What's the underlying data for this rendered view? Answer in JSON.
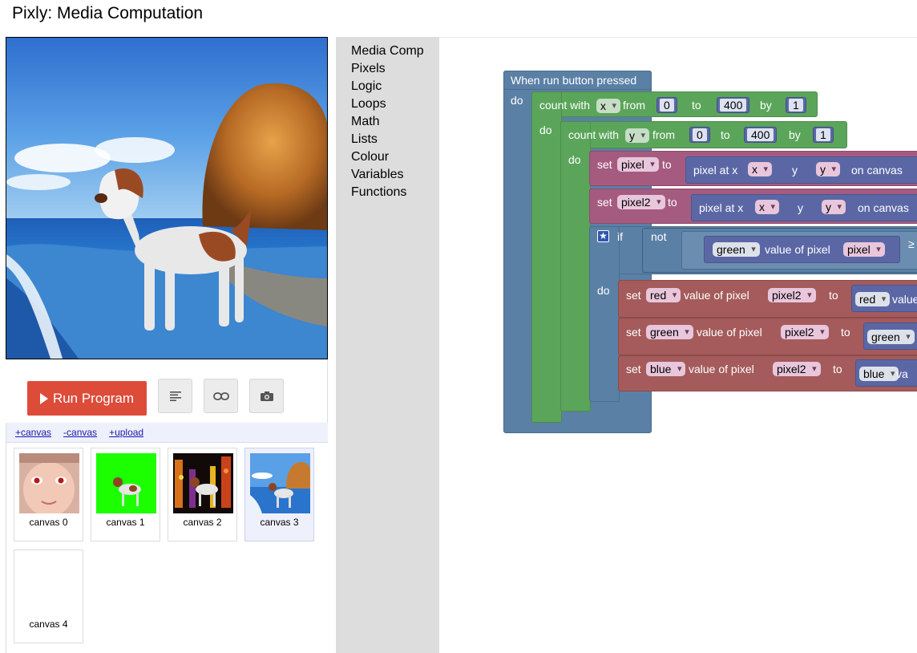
{
  "app": {
    "title": "Pixly: Media Computation"
  },
  "controls": {
    "run_label": "Run Program",
    "tools": [
      {
        "name": "code-view-icon"
      },
      {
        "name": "link-icon"
      },
      {
        "name": "camera-icon"
      }
    ]
  },
  "canvas_panel": {
    "toolbar": [
      "+canvas",
      "-canvas",
      "+upload"
    ],
    "canvases": [
      {
        "label": "canvas 0",
        "scene": "baby-portrait"
      },
      {
        "label": "canvas 1",
        "scene": "dog-on-green"
      },
      {
        "label": "canvas 2",
        "scene": "dog-on-city-night"
      },
      {
        "label": "canvas 3",
        "scene": "dog-on-beach",
        "selected": true
      },
      {
        "label": "canvas 4",
        "scene": "blank"
      }
    ]
  },
  "toolbox": {
    "categories": [
      "Media Comp",
      "Pixels",
      "Logic",
      "Loops",
      "Math",
      "Lists",
      "Colour",
      "Variables",
      "Functions"
    ]
  },
  "workspace": {
    "event": {
      "header": "When run button pressed",
      "do": "do"
    },
    "loop_x": {
      "label": "count with",
      "var": "x",
      "from": "from",
      "start": "0",
      "to": "to",
      "end": "400",
      "by": "by",
      "step": "1",
      "do": "do"
    },
    "loop_y": {
      "label": "count with",
      "var": "y",
      "from": "from",
      "start": "0",
      "to": "to",
      "end": "400",
      "by": "by",
      "step": "1",
      "do": "do"
    },
    "set_pixel": {
      "set": "set",
      "var": "pixel",
      "to": "to",
      "func": "pixel at x",
      "x": "x",
      "y_label": "y",
      "y": "y",
      "canvas": "on canvas"
    },
    "set_pixel2": {
      "set": "set",
      "var": "pixel2",
      "to": "to",
      "func": "pixel at x",
      "x": "x",
      "y_label": "y",
      "y": "y",
      "canvas": "on canvas"
    },
    "if_block": {
      "if": "if",
      "not": "not",
      "channel": "green",
      "value_of": "value of pixel",
      "pixel": "pixel",
      "compare": "≥",
      "do": "do"
    },
    "set_red": {
      "set": "set",
      "channel": "red",
      "value_of": "value of pixel",
      "pixel": "pixel2",
      "to": "to",
      "src_channel": "red",
      "src_value": "value"
    },
    "set_green": {
      "set": "set",
      "channel": "green",
      "value_of": "value of pixel",
      "pixel": "pixel2",
      "to": "to",
      "src_channel": "green"
    },
    "set_blue": {
      "set": "set",
      "channel": "blue",
      "value_of": "value of pixel",
      "pixel": "pixel2",
      "to": "to",
      "src_channel": "blue",
      "src_value": "va"
    }
  },
  "colors": {
    "event": "#5b80a5",
    "loop": "#5ba55b",
    "variable": "#a55b80",
    "pixel_set": "#a55b5b",
    "media": "#5b67a5",
    "run": "#dd4b39"
  }
}
